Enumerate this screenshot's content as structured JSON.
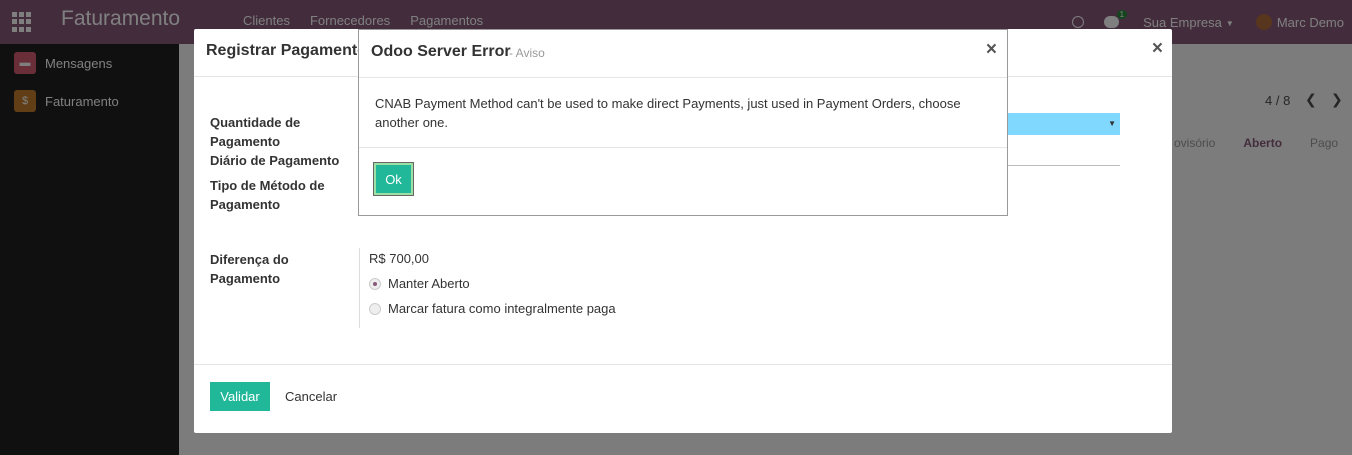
{
  "navbar": {
    "app_title": "Faturamento",
    "menu": [
      "Clientes",
      "Fornecedores",
      "Pagamentos"
    ],
    "chat_badge": "1",
    "company": "Sua Empresa",
    "user": "Marc Demo"
  },
  "sidebar": {
    "items": [
      {
        "label": "Mensagens",
        "icon": "chat-bubble-icon"
      },
      {
        "label": "Faturamento",
        "icon": "invoice-icon"
      }
    ]
  },
  "background": {
    "pager": "4 / 8",
    "status_steps": [
      "ovisório",
      "Aberto",
      "Pago"
    ],
    "active_status": "Aberto"
  },
  "payment_dialog": {
    "title": "Registrar Pagamento",
    "labels": {
      "amount": "Quantidade de Pagamento",
      "journal": "Diário de Pagamento",
      "method": "Tipo de Método de Pagamento",
      "difference": "Diferença do Pagamento"
    },
    "difference_value": "R$ 700,00",
    "options": [
      {
        "label": "Manter Aberto",
        "checked": true
      },
      {
        "label": "Marcar fatura como integralmente paga",
        "checked": false
      }
    ],
    "validate_label": "Validar",
    "cancel_label": "Cancelar"
  },
  "error_dialog": {
    "title": "Odoo Server Error",
    "subtitle": "- Aviso",
    "message": "CNAB Payment Method can't be used to make direct Payments, just used in Payment Orders, choose another one.",
    "ok_label": "Ok"
  },
  "colors": {
    "navbar": "#875a7b",
    "sidebar": "#212121",
    "primary_button": "#21b799",
    "select_highlight": "#80d8ff"
  }
}
